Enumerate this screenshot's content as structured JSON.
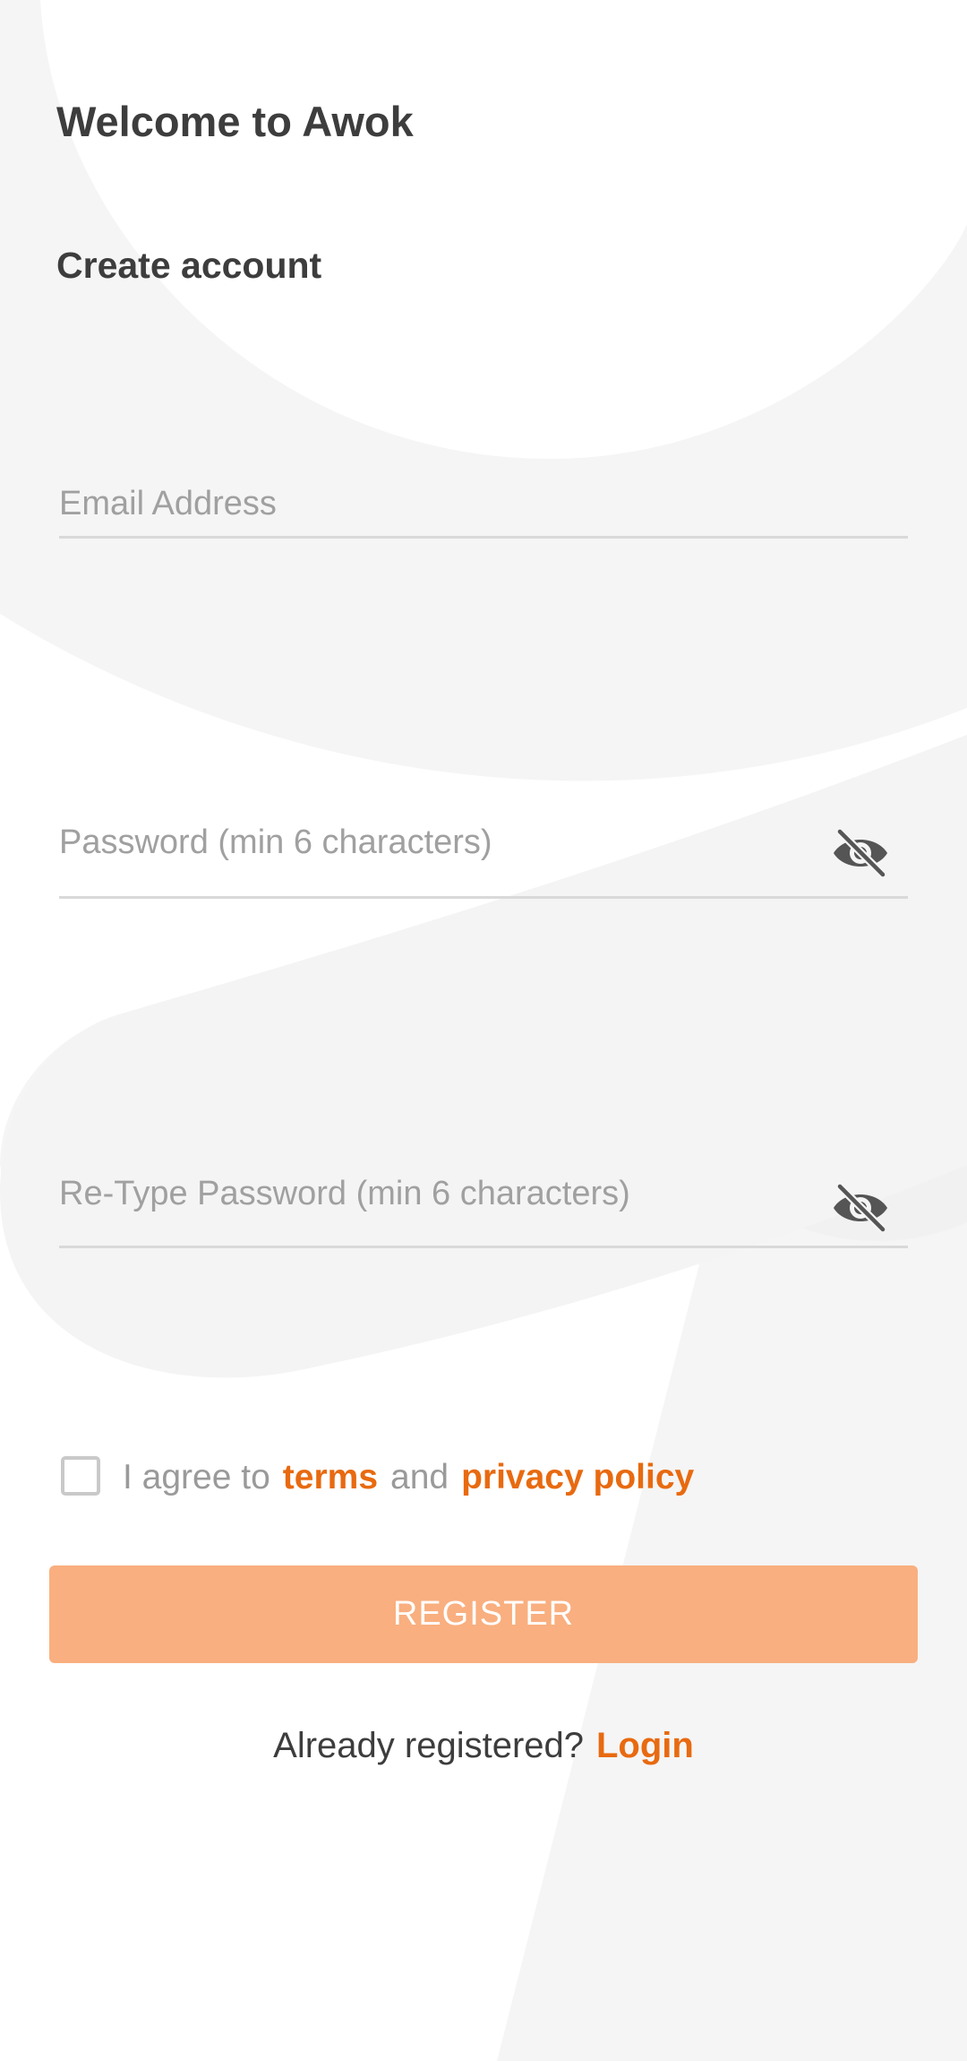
{
  "header": {
    "title": "Welcome to Awok",
    "subtitle": "Create account"
  },
  "form": {
    "email": {
      "placeholder": "Email Address",
      "value": ""
    },
    "password": {
      "placeholder": "Password (min 6 characters)",
      "value": "",
      "icon": "eye-off-icon"
    },
    "retype_password": {
      "placeholder": "Re-Type Password (min 6 characters)",
      "value": "",
      "icon": "eye-off-icon"
    }
  },
  "agreement": {
    "checked": false,
    "prefix": "I agree to",
    "terms_link": "terms",
    "conjunction": "and",
    "privacy_link": "privacy policy"
  },
  "register_button": {
    "label": "REGISTER"
  },
  "footer": {
    "question": "Already registered?",
    "login_link": "Login"
  },
  "colors": {
    "accent": "#e86a10",
    "button": "#f9af7f",
    "text": "#3d3d3d",
    "placeholder": "#a0a0a0",
    "background": "#f5f5f5"
  }
}
